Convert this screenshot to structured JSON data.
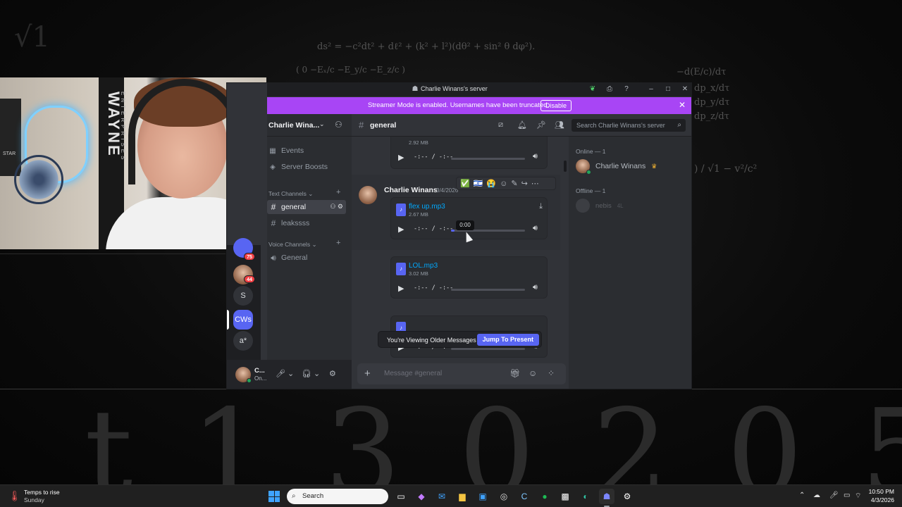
{
  "background": {
    "formulas": [
      "ds² = −c²dt² + dℓ² + (k² + l²)(dθ² + sin² θ dφ²).",
      "( 0   −Eₓ/c   −E_y/c   −E_z/c )",
      "−d(E/c)/dτ",
      "dp_x/dτ",
      "dp_y/dτ",
      "dp_z/dτ",
      ") / √1 − v²/c²",
      "√1"
    ],
    "digits": "t 1 3 0 2 0 5"
  },
  "webcam": {
    "banner_text": "WAYNE",
    "banner_sub": "ENTERPRISES",
    "poster_text": "STAR"
  },
  "discord": {
    "window_title": "Charlie Winans's server",
    "streamer_bar": {
      "message": "Streamer Mode is enabled. Usernames have been truncated.",
      "disable_label": "Disable"
    },
    "rail": {
      "items": [
        {
          "label": "",
          "badge": "75"
        },
        {
          "label": "",
          "badge": "44"
        },
        {
          "label": "S",
          "badge": ""
        },
        {
          "label": "CWs",
          "badge": ""
        },
        {
          "label": "a*",
          "badge": ""
        }
      ]
    },
    "sidebar": {
      "server_name": "Charlie Wina...",
      "links": [
        {
          "icon": "calendar-icon",
          "label": "Events"
        },
        {
          "icon": "boost-icon",
          "label": "Server Boosts"
        }
      ],
      "text_category": "Text Channels",
      "voice_category": "Voice Channels",
      "text_channels": [
        {
          "name": "general",
          "active": true
        },
        {
          "name": "leakssss",
          "active": false
        }
      ],
      "voice_channels": [
        {
          "name": "General"
        }
      ]
    },
    "user_panel": {
      "name": "C...",
      "status": "On..."
    },
    "chat": {
      "channel": "general",
      "search_placeholder": "Search Charlie Winans's server",
      "composer_placeholder": "Message #general",
      "message": {
        "author": "Charlie Winans",
        "date": "3/4/2026",
        "reactions": [
          "✅",
          "🇮🇱",
          "😭"
        ]
      },
      "attachments": [
        {
          "name": "",
          "size": "2.92 MB",
          "time": "-:-- / -:--",
          "progress": 0
        },
        {
          "name": "flex up.mp3",
          "size": "2.67 MB",
          "time": "-:-- / -:--",
          "progress": 0.05
        },
        {
          "name": "LOL.mp3",
          "size": "3.02 MB",
          "time": "-:-- / -:--",
          "progress": 0
        },
        {
          "name": "",
          "size": "",
          "time": "-:-- / -:--",
          "progress": 0
        }
      ],
      "tooltip": "0:00",
      "older_banner": {
        "text": "You're Viewing Older Messages",
        "jump_label": "Jump To Present"
      }
    },
    "members": {
      "online_header": "Online — 1",
      "offline_header": "Offline — 1",
      "online": [
        {
          "name": "Charlie Winans",
          "crown": true
        }
      ],
      "offline": [
        {
          "name": "nebis",
          "tag": "4L"
        }
      ]
    }
  },
  "taskbar": {
    "weather_title": "Temps to rise",
    "weather_sub": "Sunday",
    "search_placeholder": "Search",
    "time": "10:50 PM",
    "date": "4/3/2026"
  }
}
